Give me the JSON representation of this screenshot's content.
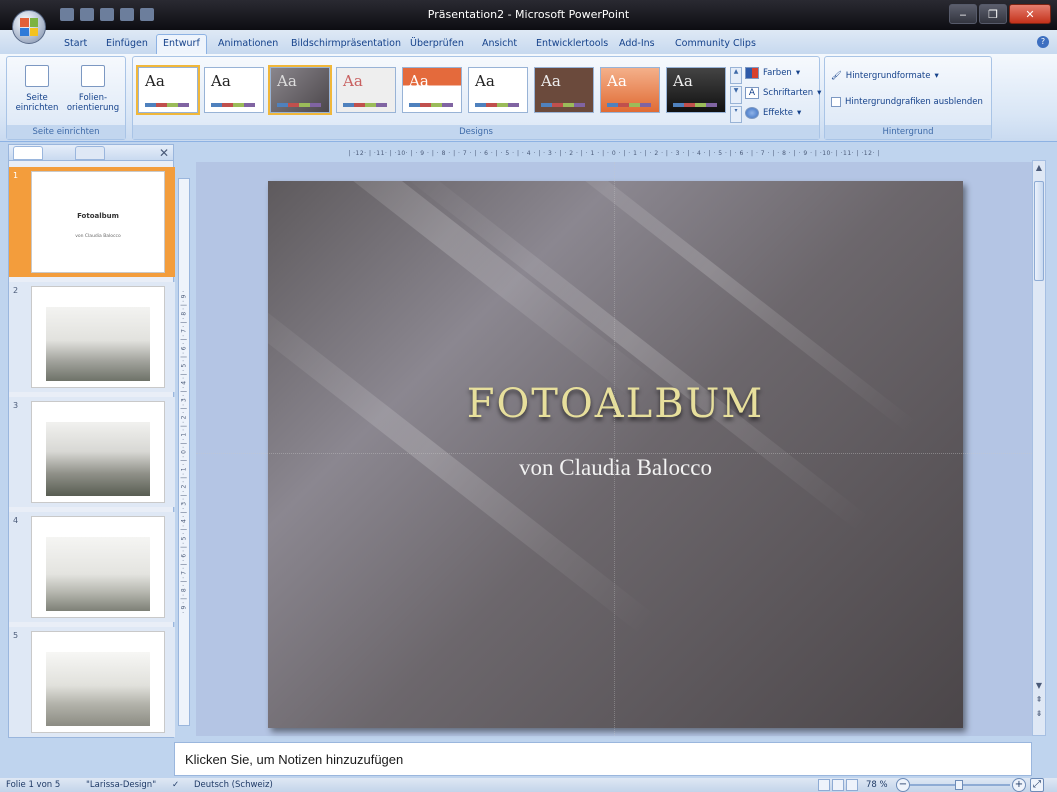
{
  "window": {
    "title": "Präsentation2 - Microsoft PowerPoint"
  },
  "ribbon_tabs": [
    "Start",
    "Einfügen",
    "Entwurf",
    "Animationen",
    "Bildschirmpräsentation",
    "Überprüfen",
    "Ansicht",
    "Entwicklertools",
    "Add-Ins",
    "Community Clips"
  ],
  "active_tab": "Entwurf",
  "page_setup": {
    "btn1_line1": "Seite",
    "btn1_line2": "einrichten",
    "btn2_line1": "Folien-",
    "btn2_line2": "orientierung",
    "group_label": "Seite einrichten"
  },
  "designs": {
    "group_label": "Designs",
    "theme_sample": "Aa",
    "colors": "Farben",
    "fonts": "Schriftarten",
    "effects": "Effekte"
  },
  "background": {
    "styles": "Hintergrundformate",
    "hide_graphics": "Hintergrundgrafiken ausblenden",
    "group_label": "Hintergrund"
  },
  "thumbnails": {
    "numbers": [
      "1",
      "2",
      "3",
      "4",
      "5"
    ],
    "slide1_title": "Fotoalbum",
    "slide1_subtitle": "von Claudia Balocco"
  },
  "ruler_h": "| ·12· | ·11· | ·10· | · 9 · | · 8 · | · 7 · | · 6 · | · 5 · | · 4 · | · 3 · | · 2 · | · 1 · | · 0 · | · 1 · | · 2 · | · 3 · | · 4 · | · 5 · | · 6 · | · 7 · | · 8 · | · 9 · | ·10· | ·11· | ·12· |",
  "ruler_v": "· 9 · | · 8 · | · 7 · | · 6 · | · 5 · | · 4 · | · 3 · | · 2 · | · 1 · | · 0 · | · 1 · | · 2 · | · 3 · | · 4 · | · 5 · | · 6 · | · 7 · | · 8 · | · 9 ·",
  "slide": {
    "title": "FOTOALBUM",
    "subtitle": "von Claudia Balocco",
    "theme_colors": {
      "title": "#e7df9c",
      "subtitle": "#f2f2f2"
    }
  },
  "notes": {
    "placeholder": "Klicken Sie, um Notizen hinzuzufügen"
  },
  "status": {
    "slide": "Folie 1 von 5",
    "design": "\"Larissa-Design\"",
    "language": "Deutsch (Schweiz)",
    "zoom": "78 %"
  },
  "colors": {
    "accent_orange": "#f39d3c",
    "ribbon_text": "#15428b",
    "title_gold": "#e7df9c"
  }
}
